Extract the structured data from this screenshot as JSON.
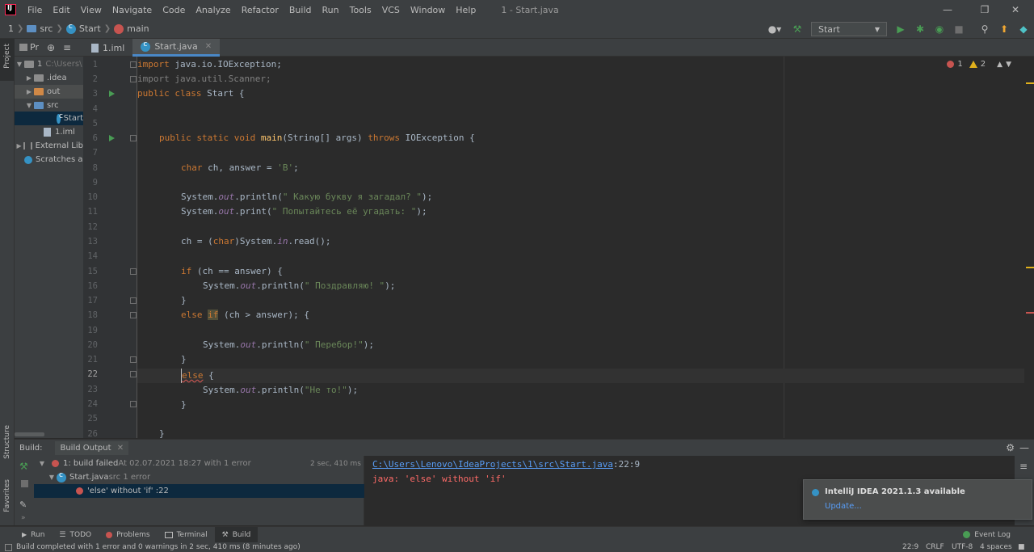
{
  "menubar": {
    "items": [
      "File",
      "Edit",
      "View",
      "Navigate",
      "Code",
      "Analyze",
      "Refactor",
      "Build",
      "Run",
      "Tools",
      "VCS",
      "Window",
      "Help"
    ],
    "window_title": "1 - Start.java"
  },
  "navbar": {
    "crumbs": [
      "1",
      "src",
      "Start",
      "main"
    ],
    "run_config": "Start"
  },
  "left_strip": {
    "project": "Project",
    "structure": "Structure",
    "favorites": "Favorites"
  },
  "project": {
    "header": "Pr",
    "rows": [
      "1",
      "C:\\Users\\",
      ".idea",
      "out",
      "src",
      "Start",
      "1.iml",
      "External Lib",
      "Scratches a"
    ]
  },
  "editor": {
    "tabs": [
      {
        "label": "1.iml"
      },
      {
        "label": "Start.java"
      }
    ],
    "error_count": "1",
    "warning_count": "2",
    "line_numbers": [
      "1",
      "2",
      "3",
      "4",
      "5",
      "6",
      "7",
      "8",
      "9",
      "10",
      "11",
      "12",
      "13",
      "14",
      "15",
      "16",
      "17",
      "18",
      "19",
      "20",
      "21",
      "22",
      "23",
      "24",
      "25",
      "26"
    ],
    "code": {
      "l1_kw": "import",
      "l1_rest": " java.io.IOException;",
      "l2": "import java.util.Scanner;",
      "l3_kw": "public class",
      "l3_rest": " Start {",
      "l6_kw": "public static void",
      "l6_fn": "main",
      "l6_mid": "(String[] args) ",
      "l6_kw2": "throws",
      "l6_rest": " IOException {",
      "l8_kw": "char",
      "l8_mid": " ch, answer = ",
      "l8_str": "'B'",
      "l8_end": ";",
      "l10_a": "System.",
      "l10_fld": "out",
      "l10_b": ".println(",
      "l10_str": "\" Какую букву я загадал? \"",
      "l10_end": ");",
      "l11_a": "System.",
      "l11_fld": "out",
      "l11_b": ".print(",
      "l11_str": "\" Попытайтесь её угадать: \"",
      "l11_end": ");",
      "l13_a": "ch = (",
      "l13_kw": "char",
      "l13_b": ")System.",
      "l13_fld": "in",
      "l13_end": ".read();",
      "l15_kw": "if",
      "l15_rest": " (ch == answer) {",
      "l16_a": "System.",
      "l16_fld": "out",
      "l16_b": ".println(",
      "l16_str": "\" Поздравляю! \"",
      "l16_end": ");",
      "l17": "}",
      "l18_kw": "else",
      "l18_sp": " ",
      "l18_if": "if",
      "l18_rest": " (ch > answer); {",
      "l20_a": "System.",
      "l20_fld": "out",
      "l20_b": ".println(",
      "l20_str": "\" Перебор!\"",
      "l20_end": ");",
      "l21": "}",
      "l22_kw": "else",
      "l22_rest": " {",
      "l23_a": "System.",
      "l23_fld": "out",
      "l23_b": ".println(",
      "l23_str": "\"Не то!\"",
      "l23_end": ");",
      "l24": "}",
      "l26": "}"
    }
  },
  "build": {
    "label": "Build:",
    "tab": "Build Output",
    "row1_title": "1: build failed",
    "row1_detail": " At 02.07.2021 18:27 with 1 error",
    "row1_time": "2 sec, 410 ms",
    "row2_file": "Start.java",
    "row2_detail": " src 1 error",
    "row3": "'else' without 'if' :22",
    "output_path": "C:\\Users\\Lenovo\\IdeaProjects\\1\\src\\Start.java",
    "output_pos": ":22:9",
    "output_error": "java: 'else' without 'if'"
  },
  "notification": {
    "title": "IntelliJ IDEA 2021.1.3 available",
    "link": "Update..."
  },
  "bottom_tools": {
    "run": "Run",
    "todo": "TODO",
    "problems": "Problems",
    "terminal": "Terminal",
    "build": "Build",
    "event_log": "Event Log"
  },
  "status": {
    "message": "Build completed with 1 error and 0 warnings in 2 sec, 410 ms (8 minutes ago)",
    "position": "22:9",
    "line_sep": "CRLF",
    "encoding": "UTF-8",
    "indent": "4 spaces"
  },
  "colors": {
    "accent": "#4a88c7",
    "error": "#c75450",
    "run_green": "#499c54"
  }
}
